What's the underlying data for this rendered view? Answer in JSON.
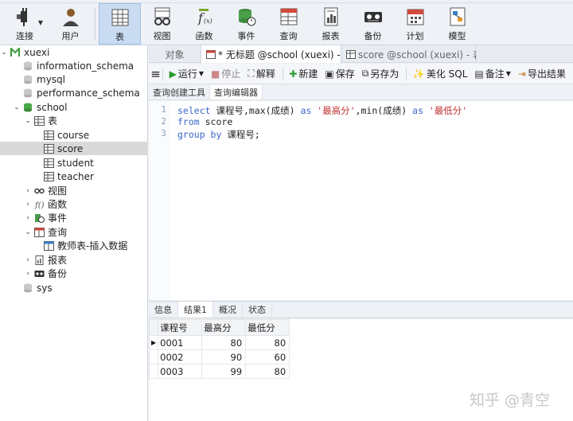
{
  "toolbar": {
    "buttons": [
      {
        "label": "连接"
      },
      {
        "label": "用户"
      },
      {
        "label": "表"
      },
      {
        "label": "视图"
      },
      {
        "label": "函数"
      },
      {
        "label": "事件"
      },
      {
        "label": "查询"
      },
      {
        "label": "报表"
      },
      {
        "label": "备份"
      },
      {
        "label": "计划"
      },
      {
        "label": "模型"
      }
    ]
  },
  "sidebar": {
    "connection": "xuexi",
    "databases": [
      "information_schema",
      "mysql",
      "performance_schema",
      "school",
      "sys"
    ],
    "school_nodes": {
      "tables_label": "表",
      "tables": [
        "course",
        "score",
        "student",
        "teacher"
      ],
      "views_label": "视图",
      "functions_label": "函数",
      "events_label": "事件",
      "queries_label": "查询",
      "query_items": [
        "教师表-插入数据"
      ],
      "reports_label": "报表",
      "backups_label": "备份"
    }
  },
  "tabs": {
    "objects": "对象",
    "tab1": "* 无标题 @school (xuexi) - 查...",
    "tab2": "score @school (xuexi) - 表"
  },
  "editor_toolbar": {
    "run": "运行",
    "stop": "停止",
    "explain": "解释",
    "new": "新建",
    "save": "保存",
    "save_as": "另存为",
    "beautify": "美化 SQL",
    "comment": "备注",
    "export": "导出结果"
  },
  "subtabs": [
    "查询创建工具",
    "查询编辑器"
  ],
  "editor": {
    "line_numbers": [
      "1",
      "2",
      "3"
    ],
    "line1": {
      "kw1": "select",
      "t1": " 课程号,max(成绩) ",
      "kw2": "as",
      "s1": " '最高分'",
      "t2": ",min(成绩) ",
      "kw3": "as",
      "s2": " '最低分'"
    },
    "line2": {
      "kw1": "from",
      "t1": " score"
    },
    "line3": {
      "kw1": "group by",
      "t1": " 课程号;"
    }
  },
  "result_tabs": [
    "信息",
    "结果1",
    "概况",
    "状态"
  ],
  "results": {
    "columns": [
      "课程号",
      "最高分",
      "最低分"
    ],
    "rows": [
      [
        "0001",
        "80",
        "80"
      ],
      [
        "0002",
        "90",
        "60"
      ],
      [
        "0003",
        "99",
        "80"
      ]
    ]
  },
  "watermark": "知乎 @青空"
}
